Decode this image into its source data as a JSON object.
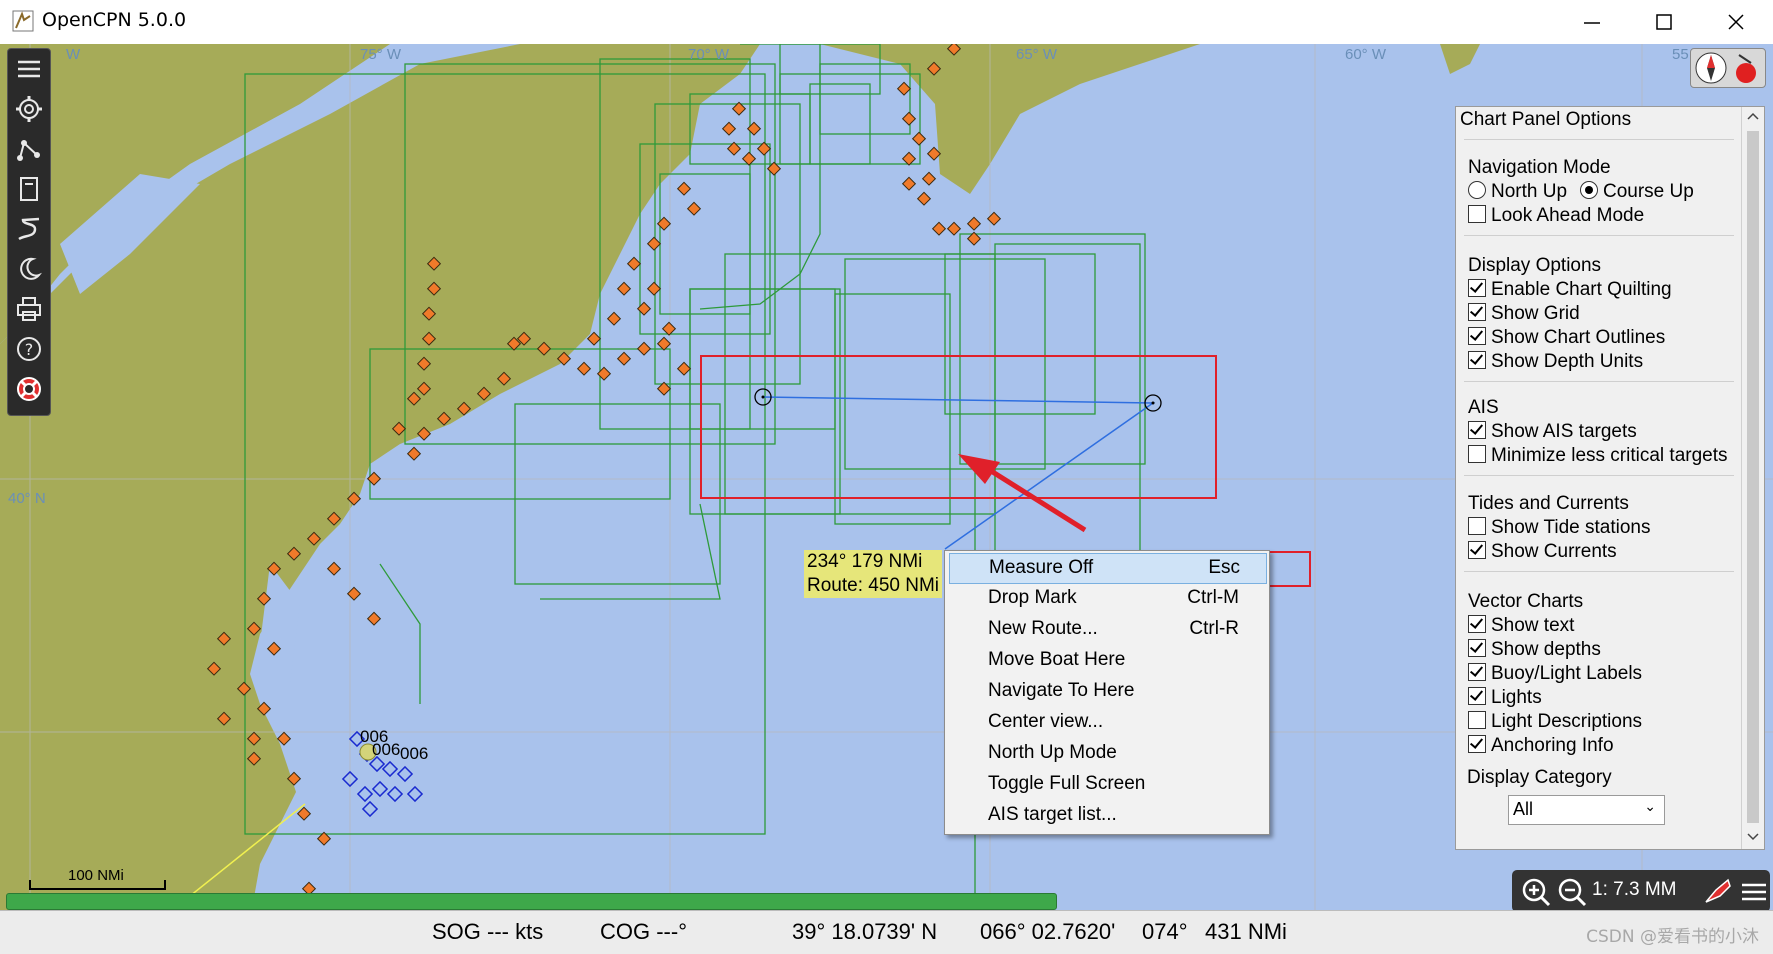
{
  "window": {
    "title": "OpenCPN 5.0.0",
    "controls": [
      "minimize-icon",
      "maximize-icon",
      "close-icon"
    ]
  },
  "grid_labels": {
    "lon_76w_partial": "W",
    "lon_75w": "75° W",
    "lon_70w": "70° W",
    "lon_65w": "65° W",
    "lon_60w": "60° W",
    "lon_55w_partial": "55",
    "lat_40n": "40° N"
  },
  "toolbar": {
    "items": [
      "menu-icon",
      "settings-icon",
      "route-icon",
      "chart-icon",
      "track-icon",
      "night-mode-icon",
      "print-icon",
      "help-icon",
      "lifebuoy-icon"
    ]
  },
  "measure": {
    "bearing_distance": "234°   179 NMi",
    "route_total": "Route: 450 NMi"
  },
  "context_menu": {
    "items": [
      {
        "label": "Measure Off",
        "shortcut": "Esc",
        "highlighted": true
      },
      {
        "label": "Drop Mark",
        "shortcut": "Ctrl-M"
      },
      {
        "label": "New Route...",
        "shortcut": "Ctrl-R"
      },
      {
        "label": "Move Boat Here",
        "shortcut": ""
      },
      {
        "label": "Navigate To Here",
        "shortcut": ""
      },
      {
        "label": "Center view...",
        "shortcut": ""
      },
      {
        "label": "North Up Mode",
        "shortcut": ""
      },
      {
        "label": "Toggle Full Screen",
        "shortcut": ""
      },
      {
        "label": "AIS target list...",
        "shortcut": ""
      }
    ]
  },
  "chart_panel": {
    "title": "Chart Panel Options",
    "navigation_mode": {
      "heading": "Navigation Mode",
      "north_up": "North Up",
      "course_up": "Course Up",
      "selected": "Course Up",
      "look_ahead": "Look Ahead Mode",
      "look_ahead_checked": false
    },
    "display_options": {
      "heading": "Display Options",
      "items": [
        {
          "label": "Enable Chart Quilting",
          "checked": true
        },
        {
          "label": "Show Grid",
          "checked": true
        },
        {
          "label": "Show Chart Outlines",
          "checked": true
        },
        {
          "label": "Show Depth Units",
          "checked": true
        }
      ]
    },
    "ais": {
      "heading": "AIS",
      "items": [
        {
          "label": "Show AIS targets",
          "checked": true
        },
        {
          "label": "Minimize less critical targets",
          "checked": false
        }
      ]
    },
    "tides": {
      "heading": "Tides and Currents",
      "items": [
        {
          "label": "Show Tide stations",
          "checked": false
        },
        {
          "label": "Show Currents",
          "checked": true
        }
      ]
    },
    "vector_charts": {
      "heading": "Vector Charts",
      "items": [
        {
          "label": "Show text",
          "checked": true
        },
        {
          "label": "Show depths",
          "checked": true
        },
        {
          "label": "Buoy/Light Labels",
          "checked": true
        },
        {
          "label": "Lights",
          "checked": true
        },
        {
          "label": "Light Descriptions",
          "checked": false
        },
        {
          "label": "Anchoring Info",
          "checked": true
        }
      ]
    },
    "display_category": {
      "heading": "Display Category",
      "value": "All"
    }
  },
  "scale_bar": "100 NMi",
  "ais_labels": [
    "006",
    "006",
    "006"
  ],
  "zoom": {
    "scale": "1: 7.3 MM"
  },
  "status": {
    "sog": "SOG --- kts",
    "cog": "COG ---°",
    "lat": "39° 18.0739' N",
    "lon": "066° 02.7620'",
    "bearing": "074°",
    "distance": "431 NMi"
  },
  "watermark": "CSDN @爱看书的小沐",
  "colors": {
    "sea": "#a9c2ec",
    "land": "#a6ab58",
    "chart_outline": "#2e9a3a",
    "highlight_red": "#e0202a",
    "route_blue": "#2f6fe0",
    "marker_orange": "#f07a2a"
  }
}
